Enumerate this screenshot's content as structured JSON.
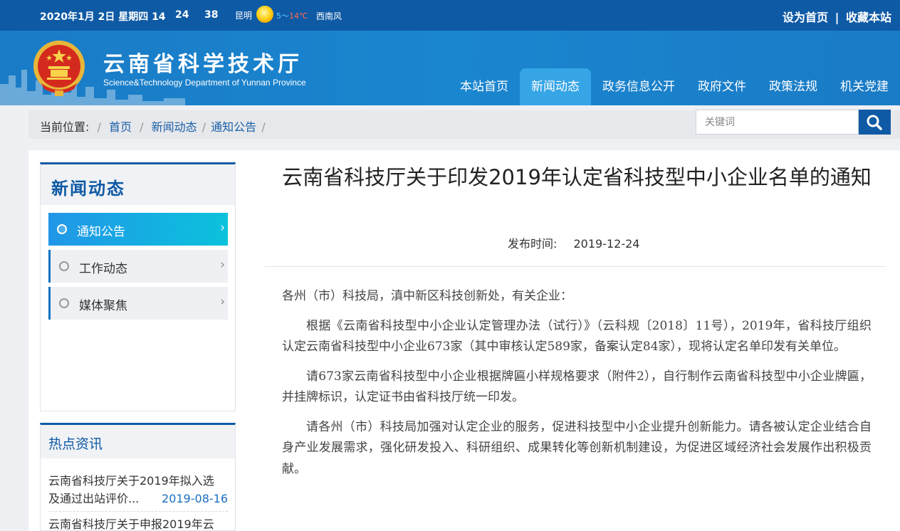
{
  "topbar": {
    "date": "2020年1月 2日 星期四 14",
    "minute": "24",
    "second": "38",
    "city": "昆明",
    "temp_low": "5～",
    "temp_high": "14℃",
    "wind": "西南风",
    "set_home": "设为首页",
    "divider": "|",
    "bookmark": "收藏本站",
    "weather_icon": "sun-icon"
  },
  "header": {
    "title": "云南省科学技术厅",
    "subtitle": "Science&Technology Department of Yunnan Province",
    "nav": [
      "本站首页",
      "新闻动态",
      "政务信息公开",
      "政府文件",
      "政策法规",
      "机关党建"
    ],
    "active_nav": "新闻动态"
  },
  "breadcrumb": {
    "prefix": "当前位置:",
    "items": [
      "首页",
      "新闻动态",
      "通知公告"
    ]
  },
  "search": {
    "placeholder": "关键词",
    "button_icon": "search-icon"
  },
  "sidebar": {
    "title": "新闻动态",
    "items": [
      "通知公告",
      "工作动态",
      "媒体聚焦"
    ],
    "active": "通知公告"
  },
  "hot_news": {
    "title": "热点资讯",
    "items": [
      {
        "title": "云南省科技厅关于2019年拟入选",
        "title2": "及通过出站评价...",
        "date": "2019-08-16"
      },
      {
        "title": "云南省科技厅关于申报2019年云"
      }
    ]
  },
  "article": {
    "title": "云南省科技厅关于印发2019年认定省科技型中小企业名单的通知",
    "pub_label": "发布时间:",
    "pub_date": "2019-12-24",
    "paragraphs": [
      "各州（市）科技局，滇中新区科技创新处，有关企业：",
      "根据《云南省科技型中小企业认定管理办法（试行）》（云科规〔2018〕11号），2019年，省科技厅组织认定云南省科技型中小企业673家（其中审核认定589家，备案认定84家），现将认定名单印发有关单位。",
      "请673家云南省科技型中小企业根据牌匾小样规格要求（附件2），自行制作云南省科技型中小企业牌匾，并挂牌标识，认定证书由省科技厅统一印发。",
      "请各州（市）科技局加强对认定企业的服务，促进科技型中小企业提升创新能力。请各被认定企业结合自身产业发展需求，强化研发投入、科研组织、成果转化等创新机制建设，为促进区域经济社会发展作出积极贡献。"
    ]
  },
  "colors": {
    "primary": "#0f5aa5",
    "header_bg": "#1a86cf",
    "active_tab": "#35a5e6",
    "active_menu_start": "#2196e8",
    "active_menu_end": "#0bc2dc"
  }
}
